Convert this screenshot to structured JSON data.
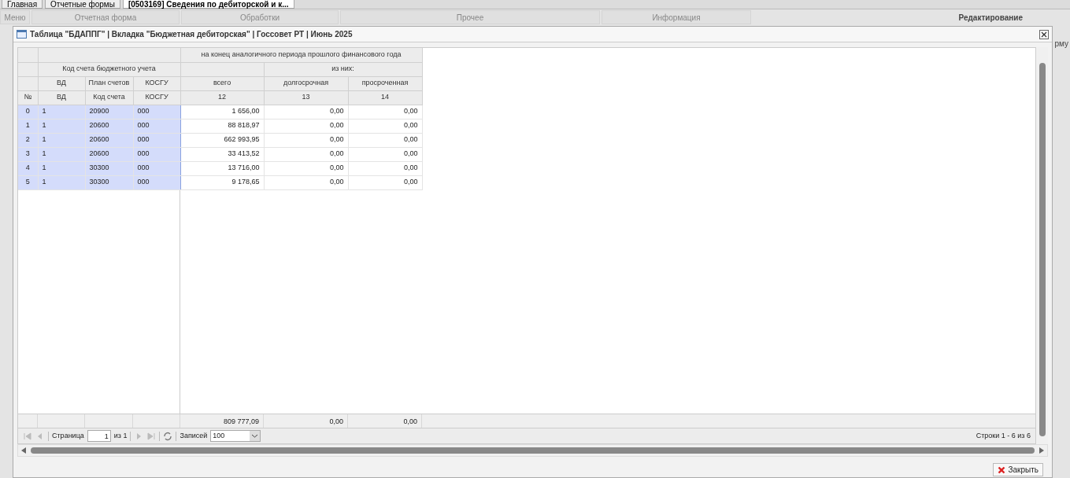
{
  "app_tabs": [
    {
      "label": "Главная",
      "selected": false
    },
    {
      "label": "Отчетные формы",
      "selected": false
    },
    {
      "label": "[0503169] Сведения по дебиторской и к...",
      "selected": true
    }
  ],
  "ribbon_groups": [
    "Меню",
    "Отчетная форма",
    "Обработки",
    "Прочее",
    "Информация"
  ],
  "ribbon_label": "Редактирование",
  "ribbon_cut_text": "рму",
  "dialog": {
    "title": "Таблица \"БДАППГ\" | Вкладка \"Бюджетная дебиторская\" | Госсовет РТ | Июнь 2025",
    "header": {
      "group_top": "на конец аналогичного периода прошлого финансового года",
      "group_left": "Код счета бюджетного учета",
      "group_sub": "из них:",
      "columns": [
        {
          "code": "№"
        },
        {
          "label": "ВД",
          "code": "ВД"
        },
        {
          "label": "План счетов",
          "code": "Код счета"
        },
        {
          "label": "КОСГУ",
          "code": "КОСГУ"
        },
        {
          "label": "всего",
          "code": "12"
        },
        {
          "label": "долгосрочная",
          "code": "13"
        },
        {
          "label": "просроченная",
          "code": "14"
        }
      ]
    },
    "rows": [
      [
        "0",
        "1",
        "20900",
        "000",
        "1 656,00",
        "0,00",
        "0,00"
      ],
      [
        "1",
        "1",
        "20600",
        "000",
        "88 818,97",
        "0,00",
        "0,00"
      ],
      [
        "2",
        "1",
        "20600",
        "000",
        "662 993,95",
        "0,00",
        "0,00"
      ],
      [
        "3",
        "1",
        "20600",
        "000",
        "33 413,52",
        "0,00",
        "0,00"
      ],
      [
        "4",
        "1",
        "30300",
        "000",
        "13 716,00",
        "0,00",
        "0,00"
      ],
      [
        "5",
        "1",
        "30300",
        "000",
        "9 178,65",
        "0,00",
        "0,00"
      ]
    ],
    "totals": [
      "809 777,09",
      "0,00",
      "0,00"
    ],
    "pager": {
      "page_label": "Страница",
      "page_value": "1",
      "of_label": "из 1",
      "records_label": "Записей",
      "records_value": "100",
      "summary": "Строки 1 - 6 из 6"
    },
    "close_button": "Закрыть"
  }
}
